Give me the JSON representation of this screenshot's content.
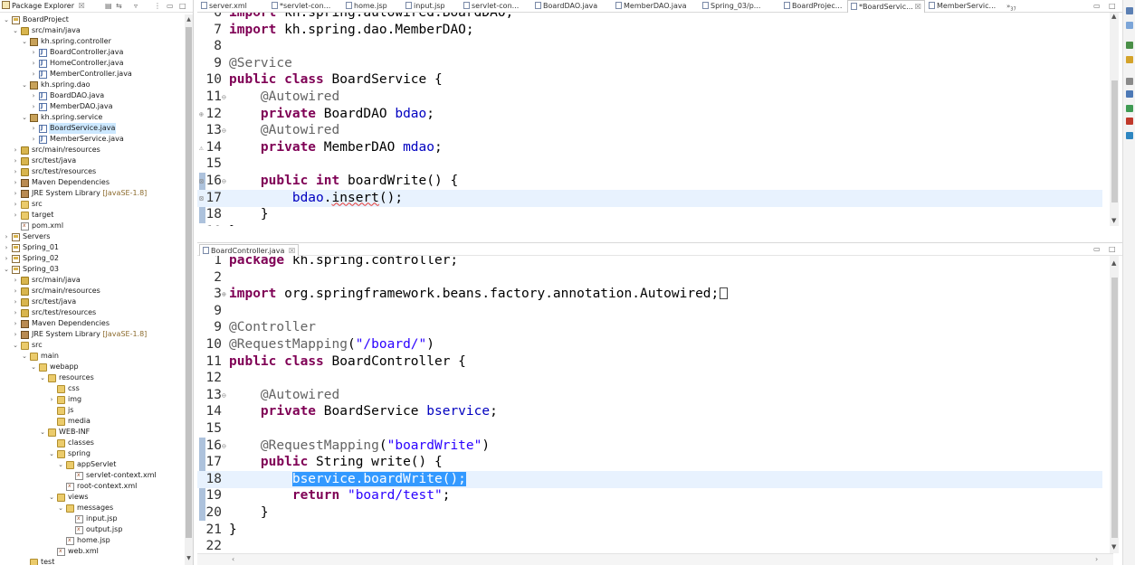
{
  "explorer": {
    "title": "Package Explorer",
    "close": "☒",
    "tree": [
      {
        "label": "BoardProject",
        "depth": 0,
        "expanded": true,
        "icon": "project"
      },
      {
        "label": "src/main/java",
        "depth": 1,
        "expanded": true,
        "icon": "src"
      },
      {
        "label": "kh.spring.controller",
        "depth": 2,
        "expanded": true,
        "icon": "package"
      },
      {
        "label": "BoardController.java",
        "depth": 3,
        "expanded": false,
        "icon": "java"
      },
      {
        "label": "HomeController.java",
        "depth": 3,
        "expanded": false,
        "icon": "java"
      },
      {
        "label": "MemberController.java",
        "depth": 3,
        "expanded": false,
        "icon": "java"
      },
      {
        "label": "kh.spring.dao",
        "depth": 2,
        "expanded": true,
        "icon": "package"
      },
      {
        "label": "BoardDAO.java",
        "depth": 3,
        "expanded": false,
        "icon": "java"
      },
      {
        "label": "MemberDAO.java",
        "depth": 3,
        "expanded": false,
        "icon": "java"
      },
      {
        "label": "kh.spring.service",
        "depth": 2,
        "expanded": true,
        "icon": "package"
      },
      {
        "label": "BoardService.java",
        "depth": 3,
        "expanded": false,
        "icon": "java",
        "selected": true
      },
      {
        "label": "MemberService.java",
        "depth": 3,
        "expanded": false,
        "icon": "java"
      },
      {
        "label": "src/main/resources",
        "depth": 1,
        "expanded": false,
        "icon": "src"
      },
      {
        "label": "src/test/java",
        "depth": 1,
        "expanded": false,
        "icon": "src"
      },
      {
        "label": "src/test/resources",
        "depth": 1,
        "expanded": false,
        "icon": "src"
      },
      {
        "label": "Maven Dependencies",
        "depth": 1,
        "expanded": false,
        "icon": "lib"
      },
      {
        "label": "JRE System Library",
        "decoration": "[JavaSE-1.8]",
        "depth": 1,
        "expanded": false,
        "icon": "lib"
      },
      {
        "label": "src",
        "depth": 1,
        "expanded": false,
        "icon": "folder"
      },
      {
        "label": "target",
        "depth": 1,
        "expanded": false,
        "icon": "folder"
      },
      {
        "label": "pom.xml",
        "depth": 1,
        "leaf": true,
        "icon": "xml"
      },
      {
        "label": "Servers",
        "depth": 0,
        "expanded": false,
        "icon": "project"
      },
      {
        "label": "Spring_01",
        "depth": 0,
        "expanded": false,
        "icon": "project"
      },
      {
        "label": "Spring_02",
        "depth": 0,
        "expanded": false,
        "icon": "project"
      },
      {
        "label": "Spring_03",
        "depth": 0,
        "expanded": true,
        "icon": "project"
      },
      {
        "label": "src/main/java",
        "depth": 1,
        "expanded": false,
        "icon": "src"
      },
      {
        "label": "src/main/resources",
        "depth": 1,
        "expanded": false,
        "icon": "src"
      },
      {
        "label": "src/test/java",
        "depth": 1,
        "expanded": false,
        "icon": "src"
      },
      {
        "label": "src/test/resources",
        "depth": 1,
        "expanded": false,
        "icon": "src"
      },
      {
        "label": "Maven Dependencies",
        "depth": 1,
        "expanded": false,
        "icon": "lib"
      },
      {
        "label": "JRE System Library",
        "decoration": "[JavaSE-1.8]",
        "depth": 1,
        "expanded": false,
        "icon": "lib"
      },
      {
        "label": "src",
        "depth": 1,
        "expanded": true,
        "icon": "folder"
      },
      {
        "label": "main",
        "depth": 2,
        "expanded": true,
        "icon": "folder"
      },
      {
        "label": "webapp",
        "depth": 3,
        "expanded": true,
        "icon": "folder"
      },
      {
        "label": "resources",
        "depth": 4,
        "expanded": true,
        "icon": "folder"
      },
      {
        "label": "css",
        "depth": 5,
        "leaf": true,
        "icon": "folder"
      },
      {
        "label": "img",
        "depth": 5,
        "expanded": false,
        "icon": "folder"
      },
      {
        "label": "js",
        "depth": 5,
        "leaf": true,
        "icon": "folder"
      },
      {
        "label": "media",
        "depth": 5,
        "leaf": true,
        "icon": "folder"
      },
      {
        "label": "WEB-INF",
        "depth": 4,
        "expanded": true,
        "icon": "folder"
      },
      {
        "label": "classes",
        "depth": 5,
        "leaf": true,
        "icon": "folder"
      },
      {
        "label": "spring",
        "depth": 5,
        "expanded": true,
        "icon": "folder"
      },
      {
        "label": "appServlet",
        "depth": 6,
        "expanded": true,
        "icon": "folder"
      },
      {
        "label": "servlet-context.xml",
        "depth": 7,
        "leaf": true,
        "icon": "xml"
      },
      {
        "label": "root-context.xml",
        "depth": 6,
        "leaf": true,
        "icon": "xml"
      },
      {
        "label": "views",
        "depth": 5,
        "expanded": true,
        "icon": "folder"
      },
      {
        "label": "messages",
        "depth": 6,
        "expanded": true,
        "icon": "folder"
      },
      {
        "label": "input.jsp",
        "depth": 7,
        "leaf": true,
        "icon": "xml"
      },
      {
        "label": "output.jsp",
        "depth": 7,
        "leaf": true,
        "icon": "xml"
      },
      {
        "label": "home.jsp",
        "depth": 6,
        "leaf": true,
        "icon": "xml"
      },
      {
        "label": "web.xml",
        "depth": 5,
        "leaf": true,
        "icon": "xml"
      },
      {
        "label": "test",
        "depth": 2,
        "leaf": true,
        "icon": "folder"
      }
    ]
  },
  "editor_tabs": [
    {
      "label": "server.xml",
      "active": false
    },
    {
      "label": "*servlet-con...",
      "active": false
    },
    {
      "label": "home.jsp",
      "active": false
    },
    {
      "label": "input.jsp",
      "active": false
    },
    {
      "label": "servlet-con...",
      "active": false
    },
    {
      "label": "BoardDAO.java",
      "active": false
    },
    {
      "label": "MemberDAO.java",
      "active": false
    },
    {
      "label": "Spring_03/p...",
      "active": false
    },
    {
      "label": "BoardProjec...",
      "active": false
    },
    {
      "label": "*BoardServic...",
      "active": true
    },
    {
      "label": "MemberServic...",
      "active": false
    }
  ],
  "tabs_overflow": "»",
  "tabs_overflow_count": "37",
  "editor1": {
    "file": "BoardService.java",
    "lines": [
      {
        "n": "6",
        "html": "<span class=\"kw\">import</span> kh.spring.autowired.BoardDAO;"
      },
      {
        "n": "7",
        "html": "<span class=\"kw\">import</span> kh.spring.dao.MemberDAO;"
      },
      {
        "n": "8",
        "html": ""
      },
      {
        "n": "9",
        "html": "<span class=\"ann\">@Service</span>"
      },
      {
        "n": "10",
        "html": "<span class=\"kw\">public</span> <span class=\"kw\">class</span> BoardService {"
      },
      {
        "n": "11",
        "html": "    <span class=\"ann\">@Autowired</span>",
        "fold": "⊖"
      },
      {
        "n": "12",
        "html": "    <span class=\"kw\">private</span> BoardDAO <span class=\"fld\">bdao</span>;",
        "ovr": "⊕"
      },
      {
        "n": "13",
        "html": "    <span class=\"ann\">@Autowired</span>",
        "fold": "⊖"
      },
      {
        "n": "14",
        "html": "    <span class=\"kw\">private</span> MemberDAO <span class=\"fld\">mdao</span>;",
        "ovr": "⚠"
      },
      {
        "n": "15",
        "html": ""
      },
      {
        "n": "16",
        "html": "    <span class=\"kw\">public</span> <span class=\"kw\">int</span> boardWrite() {",
        "fold": "⊖",
        "ovr": "⊠"
      },
      {
        "n": "17",
        "html": "        <span class=\"fld\">bdao</span>.<span class=\"squiggle\">insert</span>();",
        "current": true,
        "ovr": "⊠"
      },
      {
        "n": "18",
        "html": "    }"
      },
      {
        "n": "19",
        "html": "}"
      }
    ]
  },
  "editor2": {
    "file": "BoardController.java",
    "lines": [
      {
        "n": "1",
        "html": "<span class=\"kw\">package</span> kh.spring.controller;"
      },
      {
        "n": "2",
        "html": ""
      },
      {
        "n": "3",
        "html": "<span class=\"kw\">import</span> org.springframework.beans.factory.annotation.Autowired;<span class=\"fold-box\"></span>",
        "fold": "⊕"
      },
      {
        "n": "9",
        "html": ""
      },
      {
        "n": "9",
        "html": "<span class=\"ann\">@Controller</span>"
      },
      {
        "n": "10",
        "html": "<span class=\"ann\">@RequestMapping</span>(<span class=\"str\">\"/board/\"</span>)"
      },
      {
        "n": "11",
        "html": "<span class=\"kw\">public</span> <span class=\"kw\">class</span> BoardController {"
      },
      {
        "n": "12",
        "html": ""
      },
      {
        "n": "13",
        "html": "    <span class=\"ann\">@Autowired</span>",
        "fold": "⊖"
      },
      {
        "n": "14",
        "html": "    <span class=\"kw\">private</span> BoardService <span class=\"fld\">bservice</span>;"
      },
      {
        "n": "15",
        "html": ""
      },
      {
        "n": "16",
        "html": "    <span class=\"ann\">@RequestMapping</span>(<span class=\"str\">\"boardWrite\"</span>)",
        "fold": "⊖"
      },
      {
        "n": "17",
        "html": "    <span class=\"kw\">public</span> String write() {"
      },
      {
        "n": "18",
        "html": "        <span class=\"sel-text\">bservice.boardWrite();</span>",
        "current": true
      },
      {
        "n": "19",
        "html": "        <span class=\"kw\">return</span> <span class=\"str\">\"board/test\"</span>;"
      },
      {
        "n": "20",
        "html": "    }"
      },
      {
        "n": "21",
        "html": "}"
      },
      {
        "n": "22",
        "html": ""
      }
    ]
  },
  "colors": {
    "keyword": "#7f0055",
    "annotation": "#646464",
    "field": "#0000c0",
    "string": "#2a00ff",
    "selection": "#3399ff",
    "current_line": "#e8f2fe",
    "tree_selection": "#cce8ff"
  }
}
